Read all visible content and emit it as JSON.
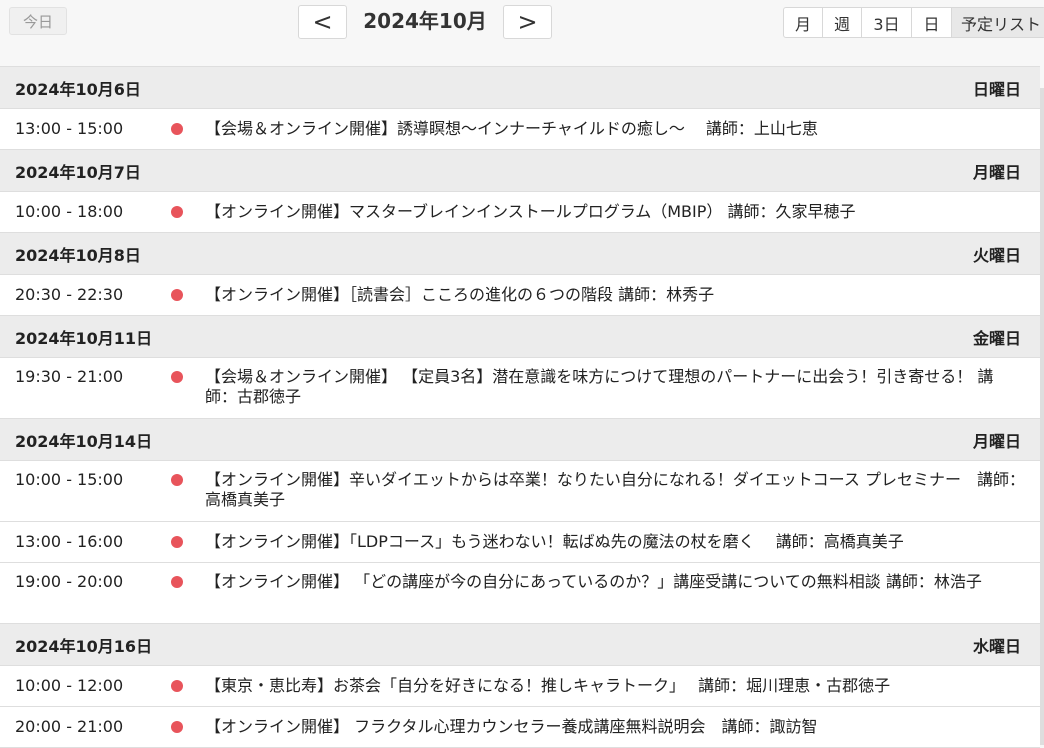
{
  "toolbar": {
    "today_label": "今日",
    "prev_label": "<",
    "next_label": ">",
    "title": "2024年10月",
    "views": [
      "月",
      "週",
      "3日",
      "日",
      "予定リスト"
    ],
    "active_view_index": 4
  },
  "days": [
    {
      "date": "2024年10月6日",
      "weekday": "日曜日",
      "events": [
        {
          "time": "13:00 - 15:00",
          "title": "【会場＆オンライン開催】誘導瞑想～インナーチャイルドの癒し～　 講師：上山七恵"
        }
      ]
    },
    {
      "date": "2024年10月7日",
      "weekday": "月曜日",
      "events": [
        {
          "time": "10:00 - 18:00",
          "title": "【オンライン開催】マスターブレインインストールプログラム（MBIP） 講師：久家早穂子"
        }
      ]
    },
    {
      "date": "2024年10月8日",
      "weekday": "火曜日",
      "events": [
        {
          "time": "20:30 - 22:30",
          "title": "【オンライン開催】［読書会］こころの進化の６つの階段 講師：林秀子"
        }
      ]
    },
    {
      "date": "2024年10月11日",
      "weekday": "金曜日",
      "events": [
        {
          "time": "19:30 - 21:00",
          "title": "【会場＆オンライン開催】 【定員3名】潜在意識を味方につけて理想のパートナーに出会う！引き寄せる！ 講師：古郡徳子"
        }
      ]
    },
    {
      "date": "2024年10月14日",
      "weekday": "月曜日",
      "events": [
        {
          "time": "10:00 - 15:00",
          "title": "【オンライン開催】辛いダイエットからは卒業！なりたい自分になれる！ダイエットコース プレセミナー　講師：高橋真美子"
        },
        {
          "time": "13:00 - 16:00",
          "title": "【オンライン開催】「LDPコース」もう迷わない！転ばぬ先の魔法の杖を磨く　 講師：高橋真美子"
        },
        {
          "time": "19:00 - 20:00",
          "title": "【オンライン開催】 「どの講座が今の自分にあっているのか？」講座受講についての無料相談 講師：林浩子"
        }
      ]
    },
    {
      "date": "2024年10月16日",
      "weekday": "水曜日",
      "events": [
        {
          "time": "10:00 - 12:00",
          "title": "【東京・恵比寿】お茶会「自分を好きになる！推しキャラトーク」　 講師：堀川理恵・古郡徳子"
        },
        {
          "time": "20:00 - 21:00",
          "title": "【オンライン開催】 フラクタル心理カウンセラー養成講座無料説明会　講師：諏訪智"
        }
      ]
    }
  ],
  "colors": {
    "event_dot": "#e8545b",
    "day_header_bg": "#ececec"
  }
}
